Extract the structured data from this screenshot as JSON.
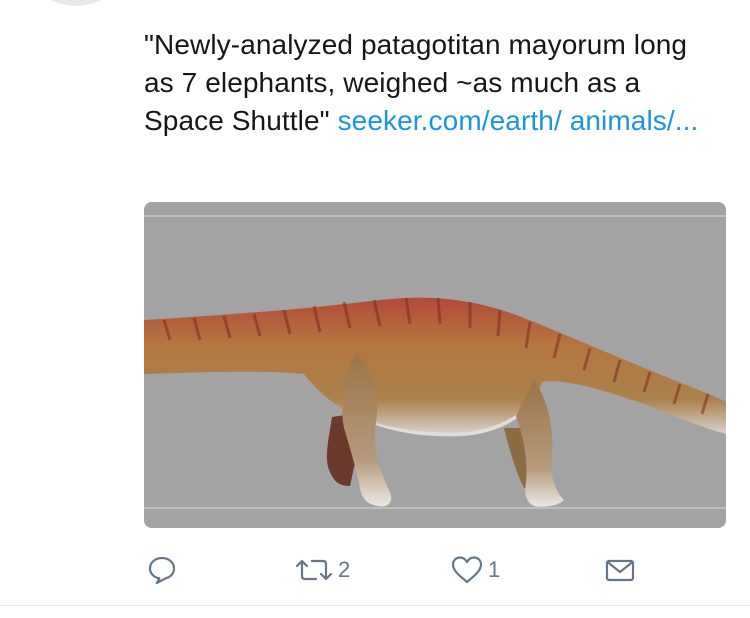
{
  "tweet": {
    "text": "\"Newly-analyzed patagotitan mayorum long as 7 elephants, weighed ~as much as a Space Shuttle\"",
    "link_text": "seeker.com/earth/ animals/..."
  },
  "media": {
    "description_icon": "image-icon"
  },
  "actions": {
    "reply_icon": "reply-icon",
    "retweet_icon": "retweet-icon",
    "retweet_count": "2",
    "like_icon": "heart-icon",
    "like_count": "1",
    "dm_icon": "envelope-icon"
  },
  "colors": {
    "link": "#1b95e0",
    "icon": "#657786",
    "text": "#14171a",
    "media_bg": "#a3a3a4"
  }
}
